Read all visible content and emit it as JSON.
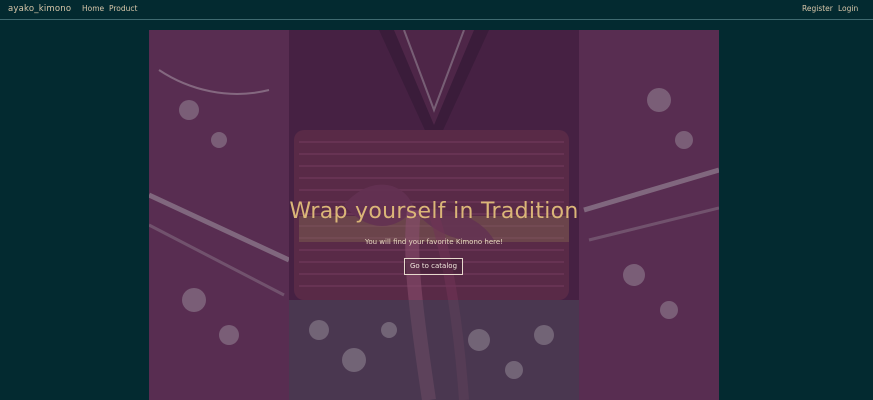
{
  "navbar": {
    "brand": "ayako_kimono",
    "links": [
      {
        "label": "Home"
      },
      {
        "label": "Product"
      }
    ],
    "auth": {
      "register_label": "Register",
      "login_label": "Login"
    }
  },
  "hero": {
    "title": "Wrap yourself in Tradition",
    "subtitle": "You will find your favorite Kimono here!",
    "cta_label": "Go to catalog",
    "image": {
      "description": "kimono"
    }
  },
  "colors": {
    "page_bg": "#032a30",
    "text_gold": "#dbb678",
    "nav_text": "#d7c6a9",
    "kimono_purple": "#6b2a57",
    "obi_band": "#7b2f55"
  }
}
